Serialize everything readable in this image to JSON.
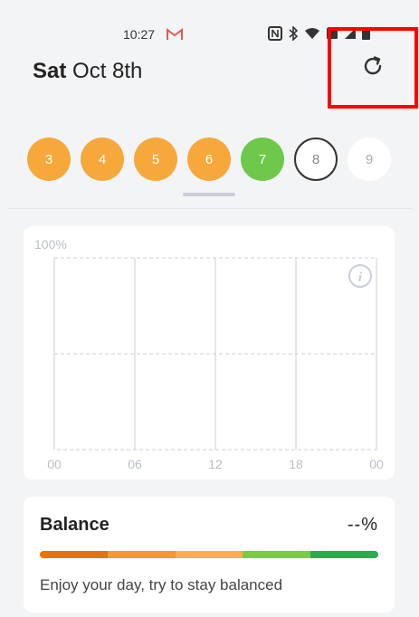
{
  "status_bar": {
    "time": "10:27",
    "icons": [
      "gmail-icon",
      "nfc-icon",
      "bluetooth-icon",
      "wifi-icon",
      "sim-icon",
      "signal-icon",
      "battery-icon"
    ]
  },
  "header": {
    "day_name": "Sat",
    "date": "Oct 8th",
    "refresh_icon": "refresh-icon",
    "highlight_color": "#ff0000"
  },
  "days": [
    {
      "label": "3",
      "state": "orange"
    },
    {
      "label": "4",
      "state": "orange"
    },
    {
      "label": "5",
      "state": "orange"
    },
    {
      "label": "6",
      "state": "orange"
    },
    {
      "label": "7",
      "state": "green"
    },
    {
      "label": "8",
      "state": "current"
    },
    {
      "label": "9",
      "state": "future"
    }
  ],
  "chart": {
    "y_max_label": "100%",
    "x_labels": [
      "00",
      "06",
      "12",
      "18",
      "00"
    ],
    "info_icon": "info-icon"
  },
  "balance": {
    "title": "Balance",
    "value": "--%",
    "message": "Enjoy your day, try to stay balanced",
    "bar_colors": [
      "#e8720c",
      "#f29a2e",
      "#f7b04a",
      "#7cc94a",
      "#2fa84f"
    ]
  },
  "colors": {
    "orange": "#f7a83a",
    "green": "#6ec94a",
    "background": "#f3f4f6"
  }
}
